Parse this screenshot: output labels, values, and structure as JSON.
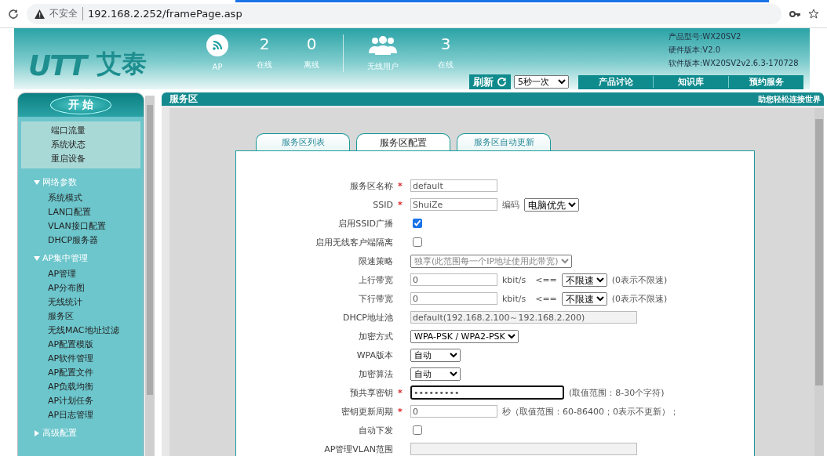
{
  "browser": {
    "security": "不安全",
    "url": "192.168.2.252/framePage.asp"
  },
  "header": {
    "logo": {
      "mark": "UTT",
      "name": "艾泰"
    },
    "stats": [
      {
        "kind": "wifi",
        "label": "AP"
      },
      {
        "kind": "count",
        "value": "2",
        "label": "在线"
      },
      {
        "kind": "count",
        "value": "0",
        "label": "离线"
      },
      {
        "kind": "users",
        "label": "无线用户"
      },
      {
        "kind": "count",
        "value": "3",
        "label": "在线"
      }
    ],
    "info": [
      "产品型号:WX20SV2",
      "硬件版本:V2.0",
      "软件版本:WX20SV2v2.6.3-170728"
    ],
    "refresh": {
      "label": "刷新",
      "interval": "5秒一次"
    },
    "nav": [
      "产品讨论",
      "知识库",
      "预约服务"
    ]
  },
  "sidebar": {
    "start": "开 始",
    "quick": [
      "端口流量",
      "系统状态",
      "重启设备"
    ],
    "sections": [
      {
        "title": "网络参数",
        "expanded": true,
        "items": [
          "系统模式",
          "LAN口配置",
          "VLAN接口配置",
          "DHCP服务器"
        ]
      },
      {
        "title": "AP集中管理",
        "expanded": true,
        "items": [
          "AP管理",
          "AP分布图",
          "无线统计",
          "服务区",
          "无线MAC地址过滤",
          "AP配置模版",
          "AP软件管理",
          "AP配置文件",
          "AP负载均衡",
          "AP计划任务",
          "AP日志管理"
        ]
      },
      {
        "title": "高级配置",
        "expanded": false
      }
    ]
  },
  "main": {
    "title": "服务区",
    "slogan": "助您轻松连接世界",
    "tabs": [
      {
        "label": "服务区列表",
        "selected": false
      },
      {
        "label": "服务区配置",
        "selected": true
      },
      {
        "label": "服务区自动更新",
        "selected": false
      }
    ],
    "rows": [
      {
        "label": "服务区名称",
        "required_mark": "*",
        "kind": "text",
        "value": "default",
        "disabled": false
      },
      {
        "label": "SSID",
        "required_mark": "*",
        "kind": "text",
        "value": "ShuiZe",
        "disabled": false,
        "suffix": "编码",
        "extra_select": "电脑优先"
      },
      {
        "label": "启用SSID广播",
        "kind": "checkbox",
        "checked": true
      },
      {
        "label": "启用无线客户端隔离",
        "kind": "checkbox",
        "checked": false
      },
      {
        "label": "限速策略",
        "kind": "select",
        "value": "独享(此范围每一个IP地址使用此带宽)",
        "disabled": true
      },
      {
        "label": "上行带宽",
        "kind": "text",
        "value": "0",
        "disabled": false,
        "unit": "kbit/s",
        "arrow": "<==",
        "extra_select": "不限速",
        "note": "(0表示不限速)"
      },
      {
        "label": "下行带宽",
        "kind": "text",
        "value": "0",
        "disabled": false,
        "unit": "kbit/s",
        "arrow": "<==",
        "extra_select": "不限速",
        "note": "(0表示不限速)"
      },
      {
        "label": "DHCP地址池",
        "kind": "wide_text",
        "value": "default(192.168.2.100～192.168.2.200)",
        "disabled": true
      },
      {
        "label": "加密方式",
        "kind": "select",
        "value": "WPA-PSK / WPA2-PSK",
        "disabled": false
      },
      {
        "label": "WPA版本",
        "kind": "small_select",
        "value": "自动",
        "disabled": false
      },
      {
        "label": "加密算法",
        "kind": "small_select",
        "value": "自动",
        "disabled": false
      },
      {
        "label": "预共享密钥",
        "required_mark": "*",
        "kind": "password",
        "value": "•••••••••",
        "disabled": false,
        "note": "(取值范围：8-30个字符)"
      },
      {
        "label": "密钥更新周期",
        "required_mark": "*",
        "kind": "text",
        "value": "0",
        "disabled": false,
        "note": "秒（取值范围：60-86400；0表示不更新）；"
      },
      {
        "label": "自动下发",
        "kind": "checkbox",
        "checked": false
      },
      {
        "label": "AP管理VLAN范围",
        "kind": "wide_text",
        "disabled": true
      }
    ]
  }
}
